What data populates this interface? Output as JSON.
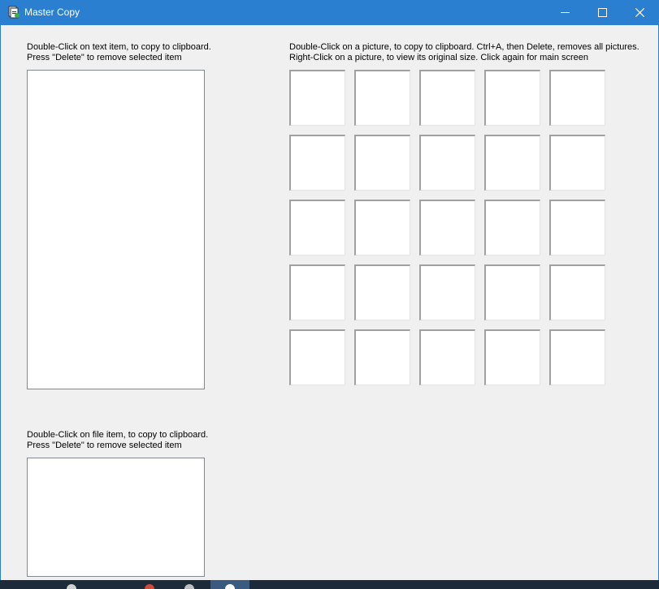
{
  "window": {
    "title": "Master Copy",
    "accent_color": "#2b7fd0",
    "controls": [
      "minimize-icon",
      "maximize-icon",
      "close-icon"
    ]
  },
  "text_panel": {
    "instruction_line1": "Double-Click on text item, to copy to clipboard.",
    "instruction_line2": "Press \"Delete\" to remove selected item",
    "items": []
  },
  "file_panel": {
    "instruction_line1": "Double-Click on file item, to copy to clipboard.",
    "instruction_line2": "Press \"Delete\" to remove selected item",
    "items": []
  },
  "picture_panel": {
    "instruction_line1": "Double-Click on a picture, to copy to clipboard.  Ctrl+A, then Delete, removes all pictures.",
    "instruction_line2": "Right-Click on a picture, to view its original size. Click again for main screen",
    "rows": 5,
    "columns": 5
  }
}
